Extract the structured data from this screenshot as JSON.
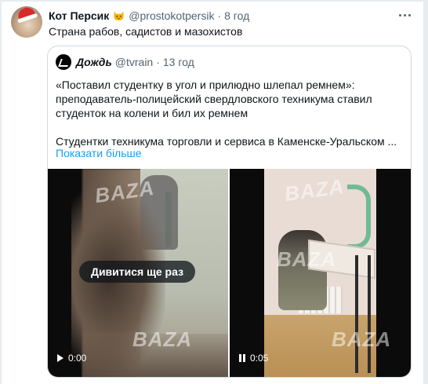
{
  "tweet": {
    "author_name": "Кот Персик",
    "handle": "@prostokotpersik",
    "separator": "·",
    "time": "8 год",
    "text": "Страна рабов, садистов и мазохистов",
    "avatar_icon": "avatar-santa-hat-icon",
    "emoji_icon": "cat-face-icon"
  },
  "quote": {
    "name": "Дождь",
    "handle": "@tvrain",
    "separator": "·",
    "time": "13 год",
    "lines": [
      "«Поставил студентку в угол и прилюдно шлепал ремнем»:",
      "преподаватель-полицейский свердловского техникума ставил",
      "студенток на колени и бил их ремнем"
    ],
    "line2": "Студентки техникума торговли и сервиса в Каменске-Уральском ...",
    "show_more": "Показати більше",
    "logo_icon": "tvrain-logo-icon"
  },
  "media": {
    "watermark": "BAZA",
    "video1": {
      "overlay": "Дивитися ще раз",
      "time": "0:00",
      "control_icon": "play-icon"
    },
    "video2": {
      "time": "0:05",
      "control_icon": "pause-icon"
    }
  },
  "colors": {
    "link": "#1d9bf0",
    "text": "#0f1419",
    "secondary": "#536471",
    "border": "#cfd9de"
  }
}
